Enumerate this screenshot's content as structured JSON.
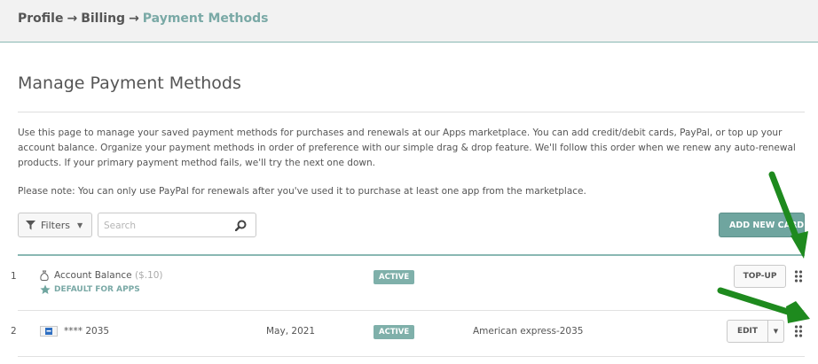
{
  "breadcrumb": {
    "items": [
      "Profile",
      "Billing",
      "Payment Methods"
    ],
    "separator": "→"
  },
  "page": {
    "title": "Manage Payment Methods",
    "intro": "Use this page to manage your saved payment methods for purchases and renewals at our Apps marketplace. You can add credit/debit cards, PayPal, or top up your account balance. Organize your payment methods in order of preference with our simple drag & drop feature. We'll follow this order when we renew any auto-renewal products. If your primary payment method fails, we'll try the next one down.",
    "note": "Please note: You can only use PayPal for renewals after you've used it to purchase at least one app from the marketplace."
  },
  "toolbar": {
    "filters_label": "Filters",
    "search_placeholder": "Search",
    "add_label": "ADD NEW CARD"
  },
  "rows": [
    {
      "num": "1",
      "icon": "money-bag-icon",
      "name": "Account Balance",
      "amount": "($.10)",
      "default_label": "DEFAULT FOR APPS",
      "expiry": "",
      "status": "ACTIVE",
      "card_label": "",
      "action": "TOP-UP"
    },
    {
      "num": "2",
      "icon": "amex-card-icon",
      "name": "**** 2035",
      "amount": "",
      "default_label": "",
      "expiry": "May, 2021",
      "status": "ACTIVE",
      "card_label": "American express-2035",
      "action": "EDIT"
    }
  ],
  "colors": {
    "accent": "#7aa9a6",
    "button_primary": "#6fa59f",
    "badge": "#7fb0aa",
    "annotation_arrow": "#1e8a1e"
  }
}
